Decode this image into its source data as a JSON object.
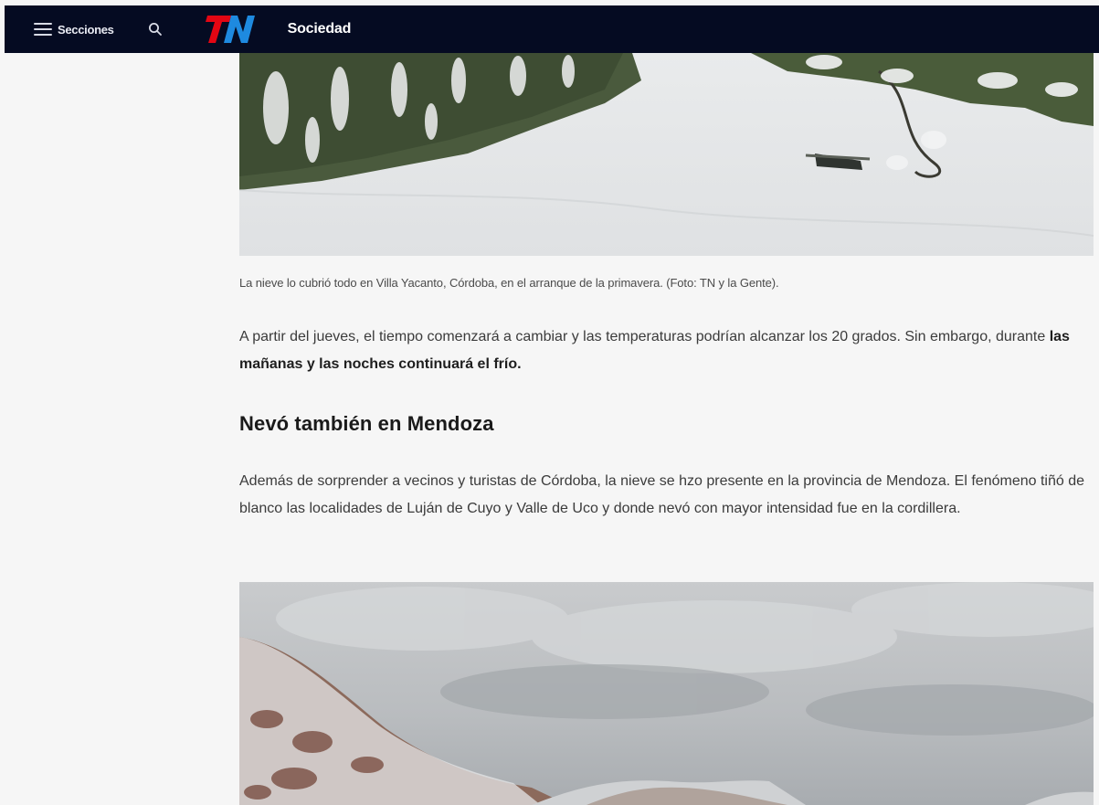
{
  "header": {
    "menu_label": "Secciones",
    "logo_text": "TN",
    "section": "Sociedad",
    "colors": {
      "background": "#050b22",
      "logo_red": "#e30613",
      "logo_blue": "#1e8ae0"
    },
    "icons": [
      "menu-icon",
      "search-icon",
      "tn-logo"
    ]
  },
  "article": {
    "caption": "La nieve lo cubrió todo en Villa Yacanto, Córdoba, en el arranque de la primavera. (Foto: TN y la Gente).",
    "paragraph1": {
      "text_a": "A partir del jueves, el tiempo comenzará a cambiar y las temperaturas podrían alcanzar los 20 grados. Sin embargo, durante ",
      "text_bold": "las mañanas y las noches continuará el frío."
    },
    "subheading": "Nevó también en Mendoza",
    "paragraph2": "Además de sorprender a vecinos y turistas de Córdoba, la nieve se hzo presente en la provincia de Mendoza. El fenómeno tiñó de blanco las localidades de Luján de Cuyo y Valle de Uco y donde nevó con mayor intensidad fue en la cordillera."
  }
}
